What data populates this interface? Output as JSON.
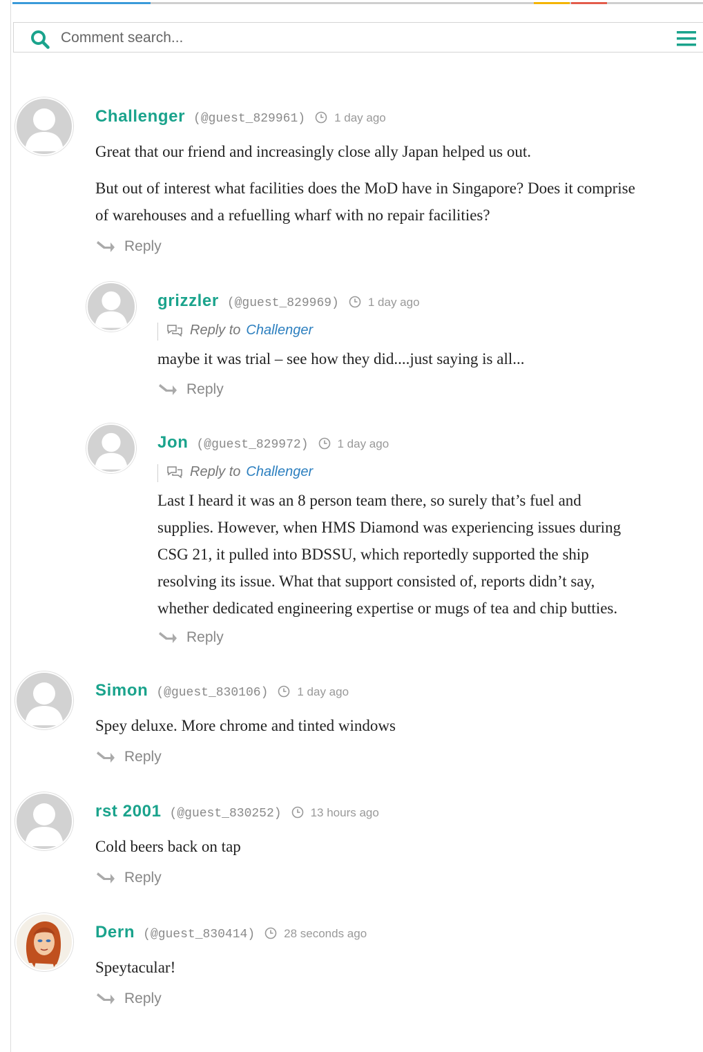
{
  "search": {
    "placeholder": "Comment search..."
  },
  "accent_colors": {
    "brand": "#1aa38c",
    "link": "#2c7fbf",
    "bar_blue": "#3a9ad9",
    "bar_orange": "#f4b400",
    "bar_red": "#e35c4b"
  },
  "comments": [
    {
      "name": "Challenger",
      "handle": "(@guest_829961)",
      "time": "1 day ago",
      "paragraphs": [
        "Great that our friend and increasingly close ally Japan helped us out.",
        "But out of interest what facilities does the MoD have in Singapore? Does it comprise",
        "of warehouses and a refuelling wharf with no repair facilities?"
      ],
      "reply": "Reply"
    },
    {
      "name": "grizzler",
      "handle": "(@guest_829969)",
      "time": "1 day ago",
      "reply_to_label": "Reply to",
      "reply_to": "Challenger",
      "paragraphs": [
        "maybe it was trial – see how they did....just saying is all..."
      ],
      "reply": "Reply"
    },
    {
      "name": "Jon",
      "handle": "(@guest_829972)",
      "time": "1 day ago",
      "reply_to_label": "Reply to",
      "reply_to": "Challenger",
      "paragraphs": [
        "Last I heard it was an 8 person team there, so surely that’s fuel and",
        "supplies. However, when HMS Diamond was experiencing issues during",
        "CSG 21, it pulled into BDSSU, which reportedly supported the ship",
        "resolving its issue. What that support consisted of, reports didn’t say,",
        "whether dedicated engineering expertise or mugs of tea and chip butties."
      ],
      "reply": "Reply"
    },
    {
      "name": "Simon",
      "handle": "(@guest_830106)",
      "time": "1 day ago",
      "paragraphs": [
        "Spey deluxe. More chrome and tinted windows"
      ],
      "reply": "Reply"
    },
    {
      "name": "rst 2001",
      "handle": "(@guest_830252)",
      "time": "13 hours ago",
      "paragraphs": [
        "Cold beers back on tap"
      ],
      "reply": "Reply"
    },
    {
      "name": "Dern",
      "handle": "(@guest_830414)",
      "time": "28 seconds ago",
      "paragraphs": [
        "Speytacular!"
      ],
      "reply": "Reply"
    }
  ]
}
